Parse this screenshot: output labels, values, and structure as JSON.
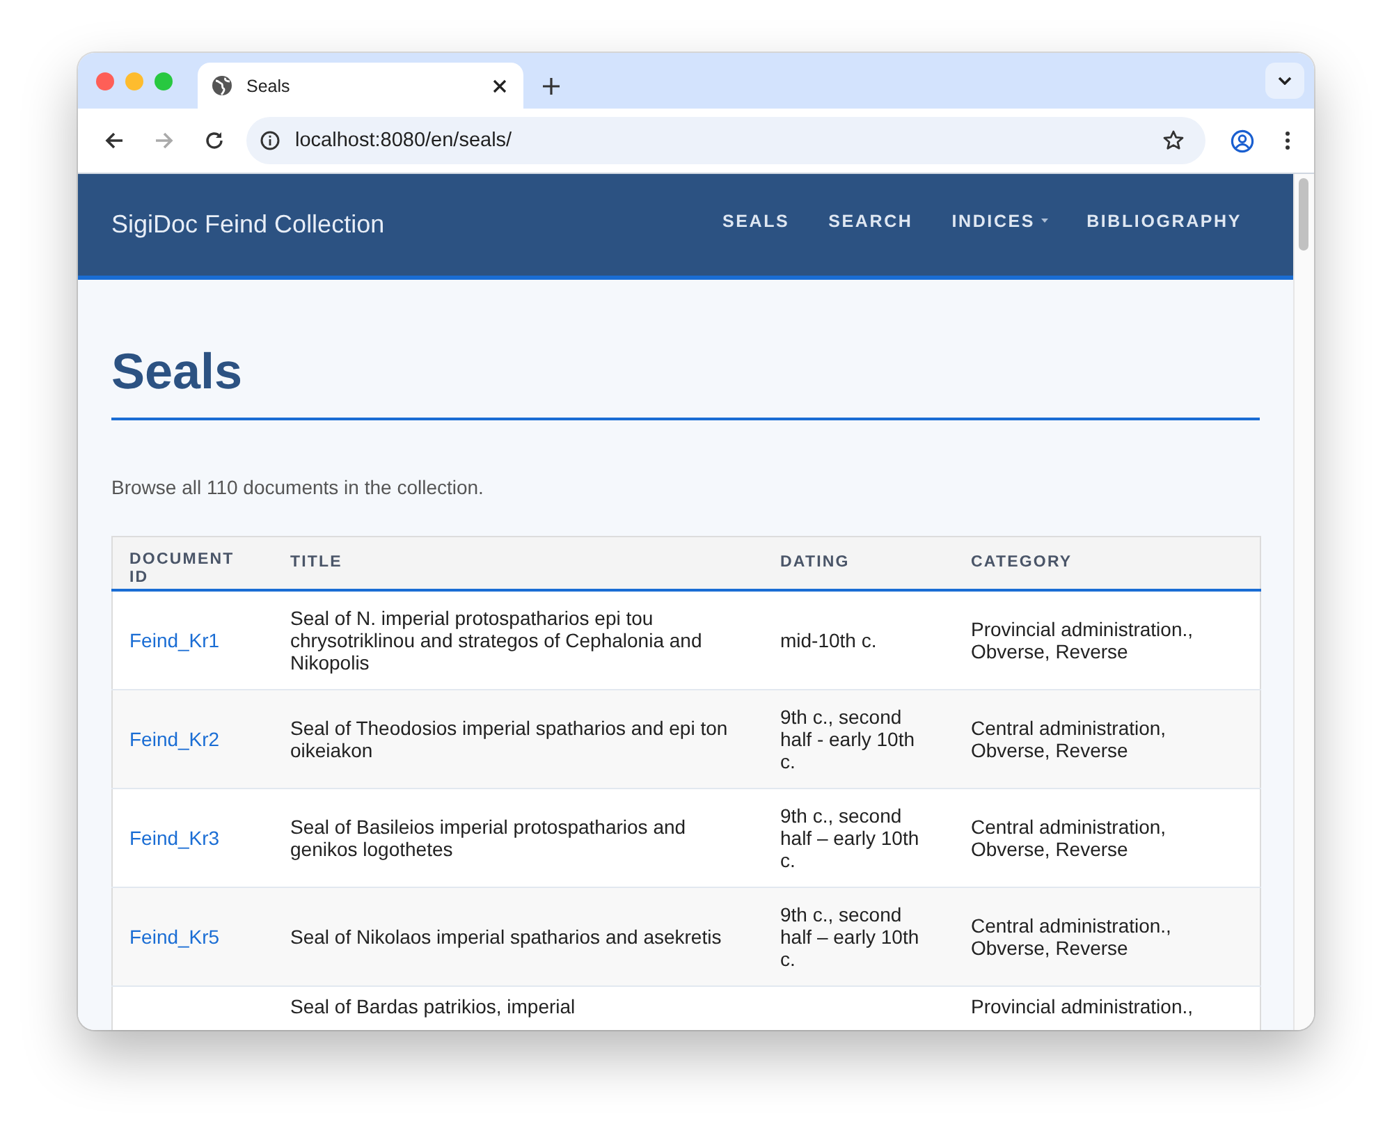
{
  "browser": {
    "tab": {
      "title": "Seals",
      "selected": true
    },
    "forward": {
      "disabled": true
    },
    "address": "localhost:8080/en/seals/"
  },
  "site": {
    "brand": "SigiDoc Feind Collection",
    "nav": [
      {
        "label": "SEALS",
        "dropdown": false
      },
      {
        "label": "SEARCH",
        "dropdown": false
      },
      {
        "label": "INDICES",
        "dropdown": true
      },
      {
        "label": "BIBLIOGRAPHY",
        "dropdown": false
      }
    ]
  },
  "page": {
    "heading": "Seals",
    "intro": "Browse all 110 documents in the collection.",
    "table": {
      "columns": [
        "DOCUMENT ID",
        "TITLE",
        "DATING",
        "CATEGORY"
      ],
      "rows": [
        {
          "id": "Feind_Kr1",
          "title": "Seal of N. imperial protospatharios epi tou chrysotriklinou and strategos of Cephalonia and Nikopolis",
          "dating": "mid-10th c.",
          "category": "Provincial administration., Obverse, Reverse"
        },
        {
          "id": "Feind_Kr2",
          "title": "Seal of Theodosios imperial spatharios and epi ton oikeiakon",
          "dating": "9th c., second half - early 10th c.",
          "category": "Central administration, Obverse, Reverse"
        },
        {
          "id": "Feind_Kr3",
          "title": "Seal of Basileios imperial protospatharios and genikos logothetes",
          "dating": "9th c., second half – early 10th c.",
          "category": "Central administration, Obverse, Reverse"
        },
        {
          "id": "Feind_Kr5",
          "title": "Seal of Nikolaos imperial spatharios and asekretis",
          "dating": "9th c., second half – early 10th c.",
          "category": "Central administration., Obverse, Reverse"
        },
        {
          "title": "Seal of Bardas patrikios, imperial",
          "category": "Provincial administration.,"
        }
      ]
    }
  }
}
